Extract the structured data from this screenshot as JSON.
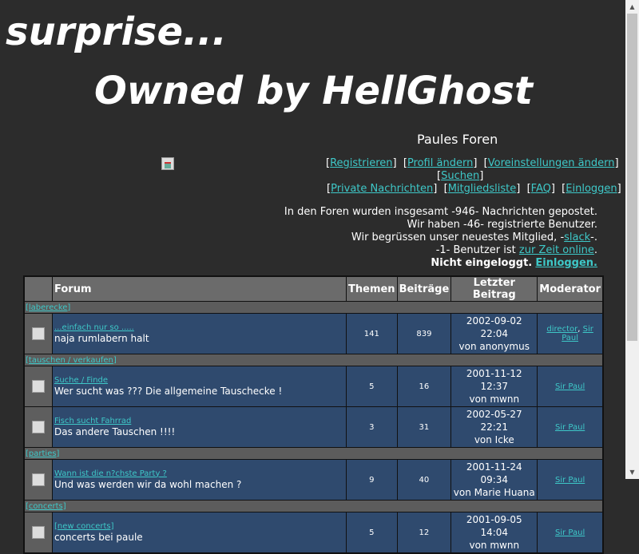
{
  "banner": {
    "line1": "surprise...",
    "line2": "Owned by HellGhost"
  },
  "site": {
    "title": "Paules Foren"
  },
  "nav": {
    "register": "Registrieren",
    "profile": "Profil ändern",
    "settings": "Voreinstellungen ändern",
    "search": "Suchen",
    "pm": "Private Nachrichten",
    "members": "Mitgliedsliste",
    "faq": "FAQ",
    "login": "Einloggen"
  },
  "stats": {
    "line1": "In den Foren wurden insgesamt -946- Nachrichten gepostet.",
    "line2": "Wir haben -46- registrierte Benutzer.",
    "line3_pre": "Wir begrüssen unser neuestes Mitglied, -",
    "newest_member": "slack",
    "line3_post": "-.",
    "line4_pre": "-1- Benutzer ist ",
    "online_link": "zur Zeit online",
    "line4_post": ".",
    "not_logged": "Nicht eingeloggt.",
    "login_link": "Einloggen."
  },
  "table": {
    "headers": {
      "forum": "Forum",
      "topics": "Themen",
      "posts": "Beiträge",
      "last": "Letzter Beitrag",
      "mod": "Moderator"
    },
    "categories": [
      {
        "name": "[laberecke]",
        "forums": [
          {
            "sub": "...einfach nur so .....",
            "desc": "naja rumlabern halt",
            "topics": "141",
            "posts": "839",
            "date": "2002-09-02 22:04",
            "by": "von anonymus",
            "mod1": "director",
            "mod2": "Sir Paul"
          }
        ]
      },
      {
        "name": "[tauschen / verkaufen]",
        "forums": [
          {
            "sub": "Suche / Finde",
            "desc": "Wer sucht was ??? Die allgemeine Tauschecke !",
            "topics": "5",
            "posts": "16",
            "date": "2001-11-12 12:37",
            "by": "von mwnn",
            "mod1": "Sir Paul"
          },
          {
            "sub": "Fisch sucht Fahrrad",
            "desc": "Das andere Tauschen !!!!",
            "topics": "3",
            "posts": "31",
            "date": "2002-05-27 22:21",
            "by": "von Icke",
            "mod1": "Sir Paul"
          }
        ]
      },
      {
        "name": "[parties]",
        "forums": [
          {
            "sub": "Wann ist die n?chste Party ?",
            "desc": "Und was werden wir da wohl machen ?",
            "topics": "9",
            "posts": "40",
            "date": "2001-11-24 09:34",
            "by": "von Marie Huana",
            "mod1": "Sir Paul"
          }
        ]
      },
      {
        "name": "[concerts]",
        "forums": [
          {
            "sub": "[new concerts]",
            "desc": "concerts bei paule",
            "topics": "5",
            "posts": "12",
            "date": "2001-09-05 14:04",
            "by": "von mwnn",
            "mod1": "Sir Paul"
          }
        ]
      }
    ]
  }
}
